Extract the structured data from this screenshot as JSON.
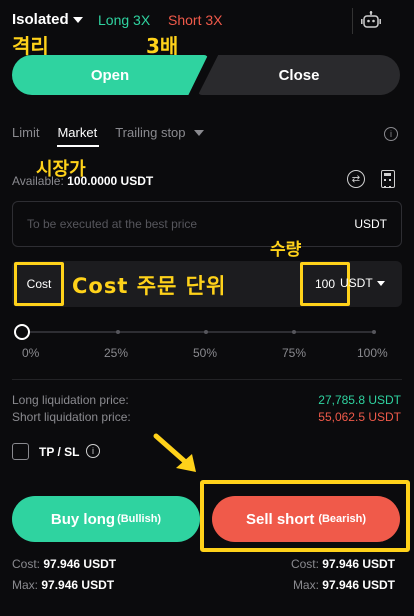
{
  "header": {
    "margin_mode": "Isolated",
    "long_leverage": "Long 3X",
    "short_leverage": "Short 3X",
    "robot_icon": "robot-icon"
  },
  "annotations": {
    "isolated_note": "격리",
    "leverage_note": "3배",
    "market_note": "시장가",
    "quantity_note": "수량",
    "cost_note": "Cost 주문 단위"
  },
  "actions": {
    "open_label": "Open",
    "close_label": "Close"
  },
  "order_tabs": [
    "Limit",
    "Market",
    "Trailing stop"
  ],
  "active_tab": "Market",
  "balance": {
    "label": "Available:",
    "value": "100.0000 USDT"
  },
  "price_field": {
    "placeholder": "To be executed at the best price",
    "unit": "USDT"
  },
  "quantity_field": {
    "mode_label": "Cost",
    "value": "100",
    "unit": "USDT"
  },
  "slider": {
    "value_percent": 0,
    "marks": [
      "0%",
      "25%",
      "50%",
      "75%",
      "100%"
    ]
  },
  "liquidation": {
    "long_label": "Long liquidation price:",
    "long_value": "27,785.8 USDT",
    "short_label": "Short liquidation price:",
    "short_value": "55,062.5 USDT"
  },
  "tpsl": {
    "label": "TP / SL"
  },
  "trade_buttons": {
    "long_label": "Buy long",
    "long_sub": "(Bullish)",
    "short_label": "Sell short",
    "short_sub": "(Bearish)"
  },
  "summary": {
    "long_cost_label": "Cost:",
    "long_cost_value": "97.946 USDT",
    "long_max_label": "Max:",
    "long_max_value": "97.946 USDT",
    "short_cost_label": "Cost:",
    "short_cost_value": "97.946 USDT",
    "short_max_label": "Max:",
    "short_max_value": "97.946 USDT"
  },
  "colors": {
    "long": "#2fd3a0",
    "short": "#f05a4a",
    "highlight": "#ffd21a",
    "background": "#0b0b0d"
  }
}
